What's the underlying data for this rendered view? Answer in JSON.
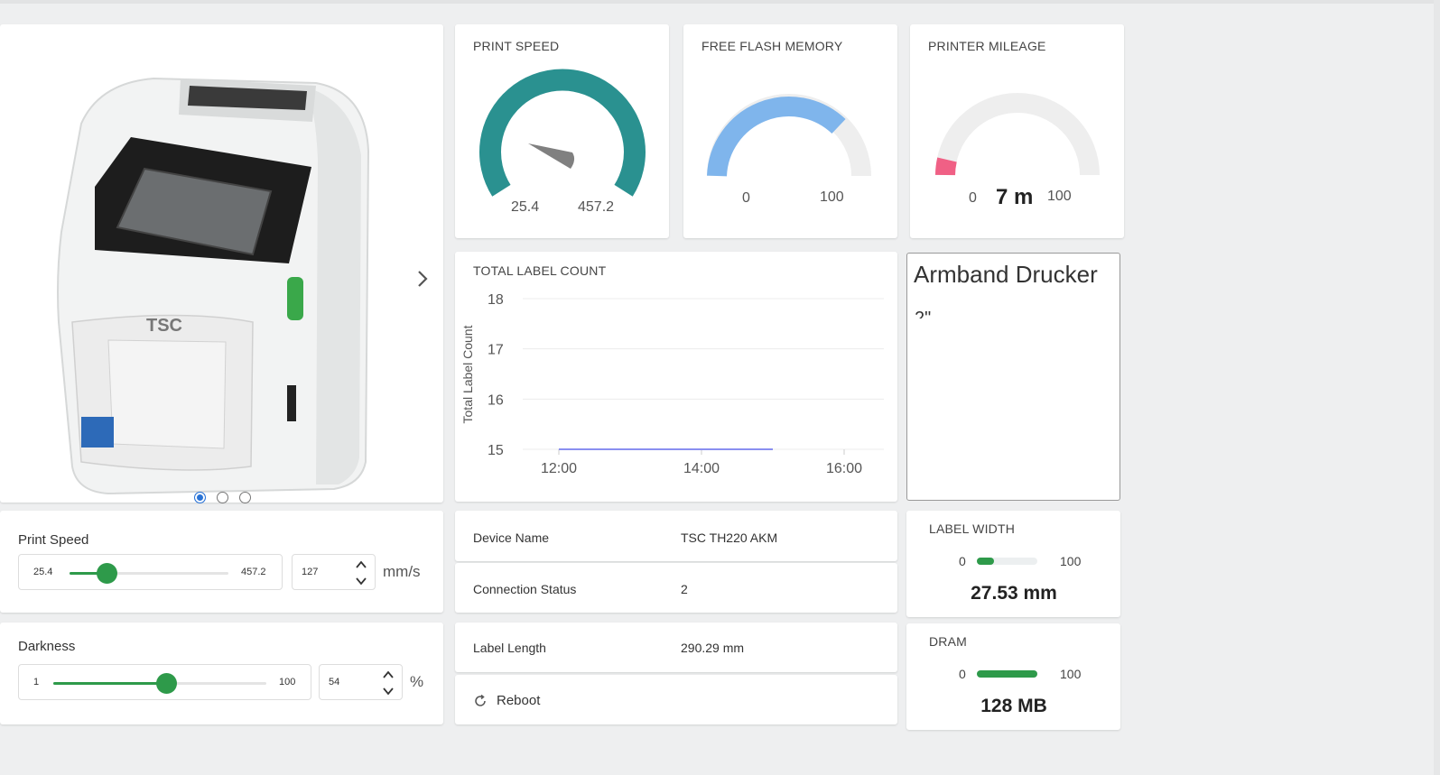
{
  "print_speed_card": {
    "title": "PRINT SPEED",
    "min": "25.4",
    "max": "457.2",
    "level": 0.24,
    "color": "#2a9190"
  },
  "flash_card": {
    "title": "FREE FLASH MEMORY",
    "min": "0",
    "max": "100",
    "level": 0.8,
    "fill_color": "#7fb5ec"
  },
  "mileage_card": {
    "title": "PRINTER MILEAGE",
    "min": "0",
    "max": "100",
    "value": "7 m",
    "level": 0.07,
    "fill_color": "#f06085"
  },
  "carousel": {
    "slides": 3,
    "active": 0,
    "icons": {
      "next": "chevron-right-icon"
    }
  },
  "print_speed_slider": {
    "title": "Print Speed",
    "min": "25.4",
    "max": "457.2",
    "value": "127",
    "unit": "mm/s",
    "level": 0.235
  },
  "darkness_slider": {
    "title": "Darkness",
    "min": "1",
    "max": "100",
    "value": "54",
    "unit": "%",
    "level": 0.53
  },
  "label_count_card": {
    "title": "TOTAL LABEL COUNT"
  },
  "chart_data": {
    "type": "line",
    "title": "TOTAL LABEL COUNT",
    "xlabel": "",
    "ylabel": "Total Label Count",
    "yticks": [
      "18",
      "17",
      "16",
      "15"
    ],
    "xticks": [
      "12:00",
      "14:00",
      "16:00"
    ],
    "ylim": [
      15,
      18
    ],
    "series": [
      {
        "x": [
          "12:00",
          "15:00"
        ],
        "y": [
          15,
          15
        ],
        "color": "#8a8ff0"
      }
    ],
    "grid": true
  },
  "description_card": {
    "title": "Armband Drucker",
    "subtitle": "2\""
  },
  "info": {
    "device_name_label": "Device Name",
    "device_name_value": "TSC TH220 AKM",
    "connection_label": "Connection Status",
    "connection_value": "2",
    "label_length_label": "Label Length",
    "label_length_value": "290.29 mm",
    "reboot_label": "Reboot"
  },
  "label_width_card": {
    "title": "LABEL WIDTH",
    "min": "0",
    "max": "100",
    "value": "27.53 mm",
    "level": 0.28
  },
  "dram_card": {
    "title": "DRAM",
    "min": "0",
    "max": "100",
    "value": "128 MB",
    "level": 1.0
  },
  "colors": {
    "accent_green": "#2e9a4a",
    "teal": "#2a9190"
  }
}
